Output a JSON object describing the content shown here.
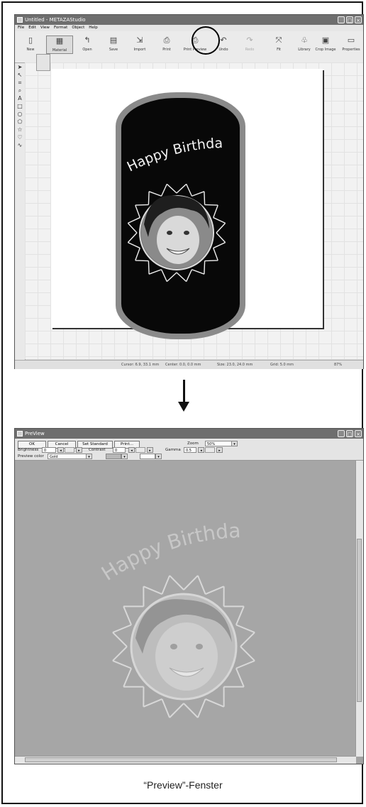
{
  "editor": {
    "title": "Untitled - METAZAStudio",
    "menu": [
      "File",
      "Edit",
      "View",
      "Format",
      "Object",
      "Help"
    ],
    "toolbar": [
      {
        "label": "New",
        "icon": "new-icon"
      },
      {
        "label": "Material",
        "icon": "material-icon"
      },
      {
        "label": "Open",
        "icon": "open-icon"
      },
      {
        "label": "Save",
        "icon": "save-icon"
      },
      {
        "label": "Import",
        "icon": "import-icon"
      },
      {
        "label": "Print",
        "icon": "print-icon"
      },
      {
        "label": "Print Preview",
        "icon": "print-preview-icon"
      },
      {
        "label": "Undo",
        "icon": "undo-icon"
      },
      {
        "label": "Redo",
        "icon": "redo-icon"
      },
      {
        "label": "Fit",
        "icon": "fit-icon"
      },
      {
        "label": "Library",
        "icon": "library-icon"
      },
      {
        "label": "Crop Image",
        "icon": "crop-image-icon"
      },
      {
        "label": "Properties",
        "icon": "properties-icon"
      }
    ],
    "tools": [
      "select-icon",
      "node-icon",
      "crop-icon",
      "zoom-icon",
      "text-icon",
      "rectangle-icon",
      "ellipse-icon",
      "polygon-icon",
      "star-icon",
      "heart-icon",
      "wave-icon"
    ],
    "design_text": "Happy Birthday",
    "status": {
      "cursor": "Cursor: 6.9, 33.1 mm",
      "center": "Center: 0.0, 0.0 mm",
      "size": "Size: 23.0, 24.0 mm",
      "grid": "Grid: 5.0 mm",
      "zoom": "87%"
    }
  },
  "preview": {
    "title": "PreView",
    "buttons": {
      "ok": "OK",
      "cancel": "Cancel",
      "set_standard": "Set Standard",
      "print": "Print..."
    },
    "zoom_label": "Zoom",
    "zoom_value": "50%",
    "brightness_label": "Brightness",
    "brightness_value": "0",
    "contrast_label": "Contrast",
    "contrast_value": "0",
    "gamma_label": "Gamma",
    "gamma_value": "0.5",
    "preview_color_label": "Preview color",
    "preview_color_value": "Gold",
    "design_text": "Happy Birthday"
  },
  "caption": "“Preview”-Fenster"
}
